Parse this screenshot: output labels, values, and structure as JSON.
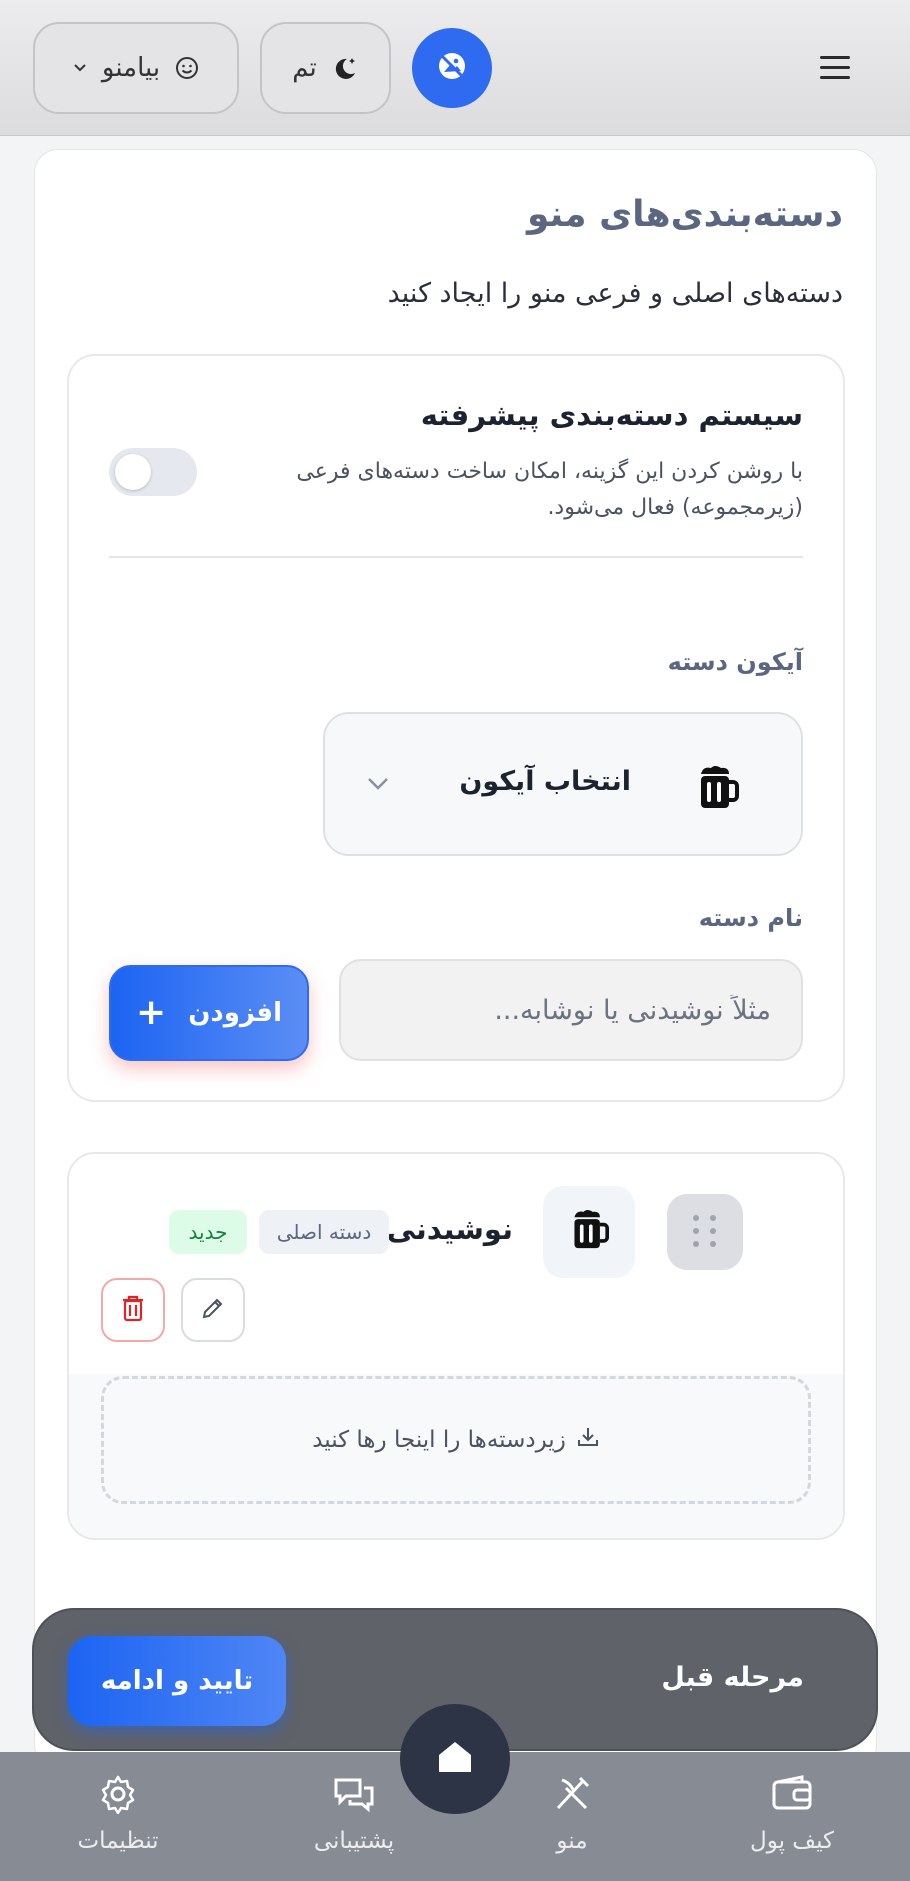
{
  "header": {
    "lang_label": "بیامنو",
    "theme_label": "تم"
  },
  "page": {
    "title": "دسته‌بندی‌های منو",
    "subtitle": "دسته‌های اصلی و فرعی منو را ایجاد کنید"
  },
  "advanced": {
    "title": "سیستم دسته‌بندی پیشرفته",
    "description": "با روشن کردن این گزینه، امکان ساخت دسته‌های فرعی (زیرمجموعه) فعال می‌شود.",
    "enabled": false
  },
  "form": {
    "icon_label": "آیکون دسته",
    "icon_select_text": "انتخاب آیکون",
    "selected_icon": "beer-mug-icon",
    "name_label": "نام دسته",
    "name_placeholder": "مثلاً نوشیدنی یا نوشابه...",
    "name_value": "",
    "add_button": "افزودن"
  },
  "categories": [
    {
      "name": "نوشیدنی",
      "icon": "beer-mug-icon",
      "badge_main": "دسته اصلی",
      "badge_new": "جدید",
      "drop_text": "زیردسته‌ها را اینجا رها کنید"
    }
  ],
  "actions": {
    "prev": "مرحله قبل",
    "confirm": "تایید و ادامه"
  },
  "nav": {
    "wallet": "کیف پول",
    "menu": "منو",
    "support": "پشتیبانی",
    "settings": "تنظیمات"
  },
  "colors": {
    "primary": "#1c64f2",
    "danger": "#dc2626",
    "success_badge_bg": "#dcfce7",
    "nav_bg": "#878b94",
    "action_bar_bg": "#5f6268"
  }
}
